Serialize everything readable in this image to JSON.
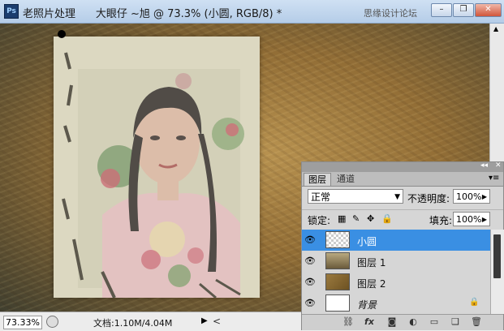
{
  "window": {
    "app_icon": "Ps",
    "doc_name": "老照片处理",
    "title_info": "大眼仔 ~旭 @ 73.3% (小圆, RGB/8) *",
    "watermark": "思缘设计论坛",
    "min_label": "–",
    "restore_label": "❐",
    "close_label": "✕"
  },
  "statusbar": {
    "zoom": "73.33%",
    "doc_info": "文档:1.10M/4.04M"
  },
  "layers_panel": {
    "tabs": [
      {
        "label": "图层",
        "active": true
      },
      {
        "label": "通道",
        "active": false
      }
    ],
    "blend_mode": "正常",
    "opacity_label": "不透明度:",
    "opacity_value": "100%",
    "lock_label": "锁定:",
    "fill_label": "填充:",
    "fill_value": "100%",
    "layers": [
      {
        "name": "小圆",
        "selected": true,
        "thumb": "checker"
      },
      {
        "name": "图层 1",
        "selected": false,
        "thumb": "portrait"
      },
      {
        "name": "图层 2",
        "selected": false,
        "thumb": "texture"
      },
      {
        "name": "背景",
        "selected": false,
        "thumb": "white",
        "locked": true
      }
    ]
  },
  "icons": {
    "eye": "eye-icon",
    "lock": "lock-icon",
    "link": "link-icon",
    "fx": "fx-icon",
    "mask": "mask-icon",
    "adjust": "adjustment-icon",
    "group": "folder-icon",
    "new": "new-layer-icon",
    "delete": "trash-icon"
  },
  "colors": {
    "selected_layer": "#3a8fe3",
    "titlebar": "#cfe0f3"
  }
}
